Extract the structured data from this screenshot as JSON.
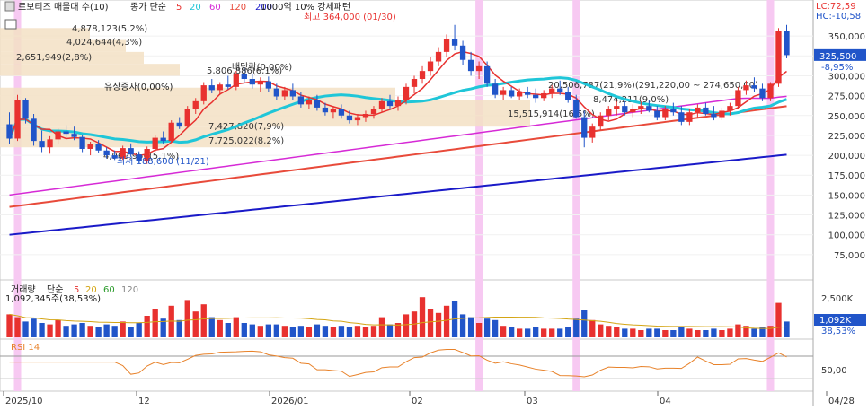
{
  "header": {
    "title": "로보티즈 매물대 수(10)",
    "ma_label": "종가 단순",
    "ma_periods": [
      "5",
      "20",
      "60",
      "120",
      "200"
    ],
    "ma_colors": [
      "#e8312f",
      "#1fc6d8",
      "#d62ad6",
      "#e84a3a",
      "#1a1ac8"
    ],
    "pattern_label": "1000억 10% 강세패턴",
    "lc": "LC:72,59",
    "hc": "HC:-10,58"
  },
  "volume_header": {
    "label": "거래량",
    "ma_label": "단순",
    "periods": [
      "5",
      "20",
      "60",
      "120"
    ],
    "colors": [
      "#e8312f",
      "#d4a514",
      "#2a9a2a",
      "#888888"
    ],
    "value_label": "1,092,345주(38,53%)"
  },
  "rsi_header": {
    "label": "RSI 14"
  },
  "price_axis": {
    "ticks": [
      "350,000",
      "325,000",
      "300,000",
      "275,000",
      "250,000",
      "225,000",
      "200,000",
      "175,000",
      "150,000",
      "125,000",
      "100,000",
      "75,000"
    ],
    "current_price": "325,500",
    "current_change": "-8,95%"
  },
  "volume_axis": {
    "ticks": [
      "2,500K"
    ],
    "current": "1,092K",
    "current_pct": "38,53%"
  },
  "rsi_axis": {
    "ticks": [
      "50,00"
    ]
  },
  "date_axis": {
    "labels": [
      "2025/10",
      "12",
      "2026/01",
      "02",
      "03",
      "04",
      "04/28"
    ]
  },
  "volume_profile_labels": [
    "4,878,123(5,2%)",
    "4,024,644(4,3%)",
    "2,651,949(2,8%)",
    "7,427,820(7,9%)",
    "7,725,022(8,2%)",
    "4,969,950(5,1%)",
    "20,506,787(21,9%)(291,220,00 ~ 274,650,00)",
    "15,515,914(16,5%)",
    "8,474,211(9,0%)",
    "5,806,886(6,1%)",
    "배당락(0,00%)"
  ],
  "annotations": {
    "high": "최고 364,000 (01/30)",
    "low": "최저 188,600 (11/21)",
    "rights_issue": "유상증자(0,00%)"
  },
  "chart_data": {
    "type": "candlestick",
    "price_range": [
      50000,
      375000
    ],
    "high_marker": {
      "value": 364000,
      "date": "01/30"
    },
    "low_marker": {
      "value": 188600,
      "date": "11/21"
    },
    "candles": [
      [
        239,
        254,
        214,
        221
      ],
      [
        221,
        276,
        218,
        269
      ],
      [
        269,
        272,
        240,
        246
      ],
      [
        246,
        252,
        212,
        218
      ],
      [
        218,
        231,
        204,
        210
      ],
      [
        210,
        224,
        202,
        220
      ],
      [
        220,
        234,
        214,
        230
      ],
      [
        230,
        238,
        222,
        227
      ],
      [
        227,
        236,
        219,
        223
      ],
      [
        223,
        226,
        204,
        208
      ],
      [
        208,
        217,
        200,
        214
      ],
      [
        214,
        219,
        203,
        206
      ],
      [
        206,
        210,
        196,
        200
      ],
      [
        200,
        206,
        194,
        196
      ],
      [
        196,
        212,
        194,
        209
      ],
      [
        209,
        215,
        198,
        201
      ],
      [
        201,
        205,
        190,
        193
      ],
      [
        193,
        211,
        189,
        208
      ],
      [
        208,
        226,
        204,
        222
      ],
      [
        222,
        230,
        214,
        218
      ],
      [
        218,
        244,
        216,
        241
      ],
      [
        241,
        248,
        233,
        236
      ],
      [
        236,
        262,
        234,
        258
      ],
      [
        258,
        272,
        252,
        268
      ],
      [
        268,
        292,
        264,
        288
      ],
      [
        288,
        296,
        278,
        282
      ],
      [
        282,
        292,
        276,
        289
      ],
      [
        289,
        300,
        283,
        286
      ],
      [
        286,
        306,
        282,
        302
      ],
      [
        302,
        310,
        292,
        296
      ],
      [
        296,
        302,
        284,
        289
      ],
      [
        289,
        298,
        280,
        293
      ],
      [
        293,
        299,
        280,
        284
      ],
      [
        284,
        290,
        270,
        274
      ],
      [
        274,
        286,
        270,
        282
      ],
      [
        282,
        290,
        270,
        274
      ],
      [
        274,
        280,
        260,
        264
      ],
      [
        264,
        274,
        258,
        270
      ],
      [
        270,
        276,
        256,
        260
      ],
      [
        260,
        266,
        250,
        254
      ],
      [
        254,
        262,
        246,
        258
      ],
      [
        258,
        264,
        246,
        250
      ],
      [
        250,
        256,
        240,
        244
      ],
      [
        244,
        252,
        238,
        248
      ],
      [
        248,
        256,
        242,
        252
      ],
      [
        252,
        262,
        246,
        258
      ],
      [
        258,
        272,
        254,
        268
      ],
      [
        268,
        276,
        258,
        262
      ],
      [
        262,
        274,
        256,
        270
      ],
      [
        270,
        290,
        264,
        286
      ],
      [
        286,
        300,
        278,
        296
      ],
      [
        296,
        312,
        290,
        306
      ],
      [
        306,
        324,
        300,
        318
      ],
      [
        318,
        336,
        312,
        330
      ],
      [
        330,
        352,
        324,
        346
      ],
      [
        346,
        364,
        332,
        338
      ],
      [
        338,
        344,
        314,
        320
      ],
      [
        320,
        330,
        300,
        306
      ],
      [
        306,
        318,
        296,
        312
      ],
      [
        312,
        318,
        286,
        290
      ],
      [
        290,
        296,
        272,
        276
      ],
      [
        276,
        286,
        270,
        282
      ],
      [
        282,
        286,
        272,
        274
      ],
      [
        274,
        284,
        270,
        280
      ],
      [
        280,
        286,
        272,
        276
      ],
      [
        276,
        284,
        266,
        272
      ],
      [
        272,
        282,
        268,
        278
      ],
      [
        278,
        288,
        272,
        284
      ],
      [
        284,
        294,
        276,
        280
      ],
      [
        280,
        286,
        266,
        270
      ],
      [
        270,
        276,
        246,
        248
      ],
      [
        248,
        256,
        210,
        222
      ],
      [
        222,
        240,
        216,
        236
      ],
      [
        236,
        254,
        232,
        250
      ],
      [
        250,
        262,
        244,
        258
      ],
      [
        258,
        268,
        250,
        262
      ],
      [
        262,
        268,
        250,
        254
      ],
      [
        254,
        264,
        248,
        258
      ],
      [
        258,
        268,
        252,
        262
      ],
      [
        262,
        270,
        254,
        256
      ],
      [
        256,
        262,
        244,
        248
      ],
      [
        248,
        262,
        244,
        258
      ],
      [
        258,
        266,
        250,
        254
      ],
      [
        254,
        262,
        238,
        242
      ],
      [
        242,
        258,
        238,
        254
      ],
      [
        254,
        264,
        248,
        260
      ],
      [
        260,
        266,
        250,
        252
      ],
      [
        252,
        262,
        244,
        248
      ],
      [
        248,
        260,
        244,
        256
      ],
      [
        256,
        266,
        250,
        262
      ],
      [
        262,
        286,
        258,
        282
      ],
      [
        282,
        294,
        276,
        288
      ],
      [
        288,
        298,
        280,
        284
      ],
      [
        284,
        290,
        268,
        272
      ],
      [
        272,
        292,
        268,
        290
      ],
      [
        290,
        360,
        286,
        356
      ],
      [
        356,
        364,
        322,
        326
      ]
    ]
  },
  "volume": [
    [
      1.6,
      1
    ],
    [
      1.4,
      1
    ],
    [
      1.1,
      0
    ],
    [
      1.3,
      0
    ],
    [
      1.0,
      0
    ],
    [
      0.9,
      1
    ],
    [
      1.2,
      1
    ],
    [
      0.8,
      0
    ],
    [
      0.9,
      0
    ],
    [
      1.0,
      0
    ],
    [
      0.8,
      1
    ],
    [
      0.7,
      0
    ],
    [
      0.9,
      0
    ],
    [
      0.8,
      0
    ],
    [
      1.1,
      1
    ],
    [
      0.7,
      0
    ],
    [
      1.0,
      0
    ],
    [
      1.5,
      1
    ],
    [
      2.0,
      1
    ],
    [
      1.3,
      0
    ],
    [
      2.2,
      1
    ],
    [
      1.2,
      0
    ],
    [
      2.6,
      1
    ],
    [
      1.8,
      1
    ],
    [
      2.3,
      1
    ],
    [
      1.4,
      0
    ],
    [
      1.2,
      1
    ],
    [
      1.0,
      0
    ],
    [
      1.4,
      1
    ],
    [
      1.0,
      0
    ],
    [
      0.9,
      0
    ],
    [
      0.8,
      1
    ],
    [
      0.9,
      0
    ],
    [
      0.9,
      0
    ],
    [
      0.8,
      1
    ],
    [
      0.7,
      0
    ],
    [
      0.8,
      0
    ],
    [
      0.7,
      1
    ],
    [
      0.9,
      0
    ],
    [
      0.8,
      0
    ],
    [
      0.7,
      1
    ],
    [
      0.8,
      0
    ],
    [
      0.7,
      0
    ],
    [
      0.8,
      1
    ],
    [
      0.7,
      1
    ],
    [
      0.8,
      1
    ],
    [
      1.4,
      1
    ],
    [
      0.9,
      0
    ],
    [
      1.0,
      1
    ],
    [
      1.6,
      1
    ],
    [
      1.8,
      1
    ],
    [
      2.8,
      1
    ],
    [
      2.0,
      1
    ],
    [
      1.7,
      1
    ],
    [
      2.2,
      1
    ],
    [
      2.5,
      0
    ],
    [
      1.6,
      0
    ],
    [
      1.4,
      0
    ],
    [
      1.0,
      1
    ],
    [
      1.3,
      0
    ],
    [
      1.2,
      0
    ],
    [
      0.8,
      1
    ],
    [
      0.7,
      0
    ],
    [
      0.6,
      1
    ],
    [
      0.6,
      0
    ],
    [
      0.7,
      0
    ],
    [
      0.6,
      1
    ],
    [
      0.6,
      1
    ],
    [
      0.6,
      0
    ],
    [
      0.7,
      0
    ],
    [
      1.3,
      0
    ],
    [
      1.9,
      0
    ],
    [
      1.2,
      1
    ],
    [
      0.9,
      1
    ],
    [
      0.8,
      1
    ],
    [
      0.7,
      1
    ],
    [
      0.6,
      0
    ],
    [
      0.6,
      1
    ],
    [
      0.5,
      1
    ],
    [
      0.6,
      0
    ],
    [
      0.6,
      0
    ],
    [
      0.5,
      1
    ],
    [
      0.5,
      0
    ],
    [
      0.7,
      0
    ],
    [
      0.6,
      1
    ],
    [
      0.5,
      1
    ],
    [
      0.5,
      0
    ],
    [
      0.6,
      0
    ],
    [
      0.5,
      1
    ],
    [
      0.6,
      1
    ],
    [
      0.9,
      1
    ],
    [
      0.8,
      1
    ],
    [
      0.6,
      0
    ],
    [
      0.7,
      0
    ],
    [
      0.8,
      1
    ],
    [
      2.4,
      1
    ],
    [
      1.1,
      0
    ]
  ],
  "colors": {
    "up": "#e8312f",
    "down": "#2155c9",
    "rsi": "#e8822a",
    "highlight": "#f7c9f2",
    "profile": "#f3e1c4"
  }
}
